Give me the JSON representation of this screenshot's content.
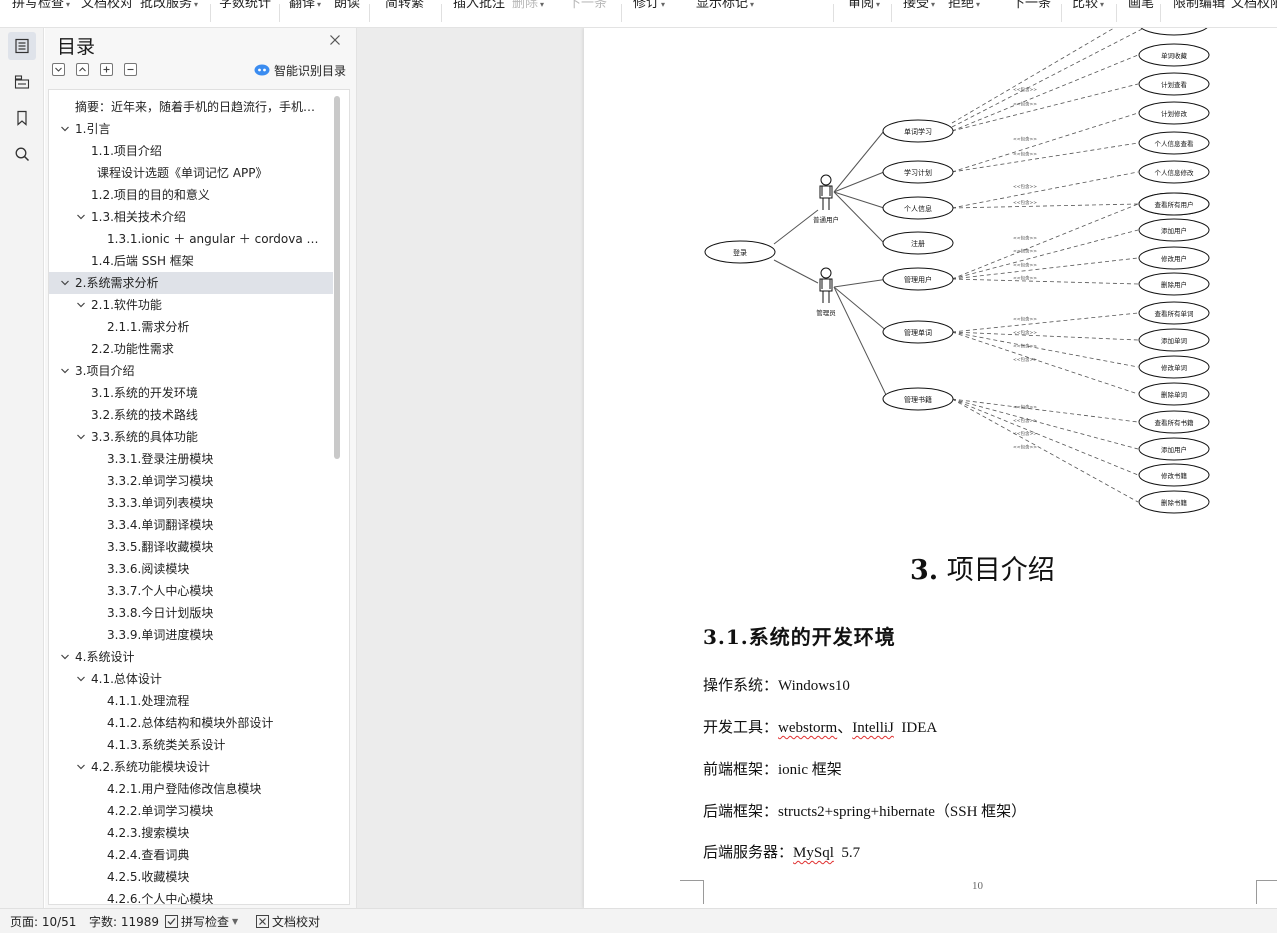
{
  "toolbar": {
    "items": [
      {
        "label": "拼写检查",
        "caret": true,
        "disabled": false
      },
      {
        "label": "文档校对",
        "caret": false,
        "disabled": false
      },
      {
        "label": "批改服务",
        "caret": true,
        "disabled": false
      },
      {
        "label": "字数统计",
        "caret": false,
        "disabled": false
      },
      {
        "label": "翻译",
        "caret": true,
        "disabled": false
      },
      {
        "label": "朗读",
        "caret": false,
        "disabled": false
      },
      {
        "label": "简转繁",
        "caret": false,
        "disabled": false
      },
      {
        "label": "插入批注",
        "caret": false,
        "disabled": false
      },
      {
        "label": "删除",
        "caret": true,
        "disabled": true
      },
      {
        "label": "下一条",
        "caret": false,
        "disabled": true
      },
      {
        "label": "修订",
        "caret": true,
        "disabled": false
      },
      {
        "label": "显示标记",
        "caret": true,
        "disabled": false
      },
      {
        "label": "审阅",
        "caret": true,
        "disabled": false
      },
      {
        "label": "接受",
        "caret": true,
        "disabled": false
      },
      {
        "label": "拒绝",
        "caret": true,
        "disabled": false
      },
      {
        "label": "下一条",
        "caret": false,
        "disabled": false
      },
      {
        "label": "比较",
        "caret": true,
        "disabled": false
      },
      {
        "label": "画笔",
        "caret": false,
        "disabled": false
      },
      {
        "label": "限制编辑",
        "caret": false,
        "disabled": false
      },
      {
        "label": "文档权限",
        "caret": false,
        "disabled": false
      }
    ]
  },
  "rail": [
    {
      "icon": "toc-icon",
      "active": true
    },
    {
      "icon": "folder-tree-icon",
      "active": false
    },
    {
      "icon": "bookmark-icon",
      "active": false
    },
    {
      "icon": "search-icon",
      "active": false
    }
  ],
  "toc": {
    "title": "目录",
    "smart_label": "智能识别目录",
    "items": [
      {
        "text": "摘要：近年来，随着手机的日趋流行，手机…",
        "level": 0,
        "toggle": "none",
        "selected": false
      },
      {
        "text": "1.引言",
        "level": 0,
        "toggle": "expanded",
        "selected": false
      },
      {
        "text": "1.1.项目介绍",
        "level": 1,
        "toggle": "none",
        "selected": false
      },
      {
        "text": "课程设计选题《单词记忆 APP》",
        "level": 1,
        "toggle": "none",
        "selected": false,
        "extra": 6
      },
      {
        "text": "1.2.项目的目的和意义",
        "level": 1,
        "toggle": "none",
        "selected": false
      },
      {
        "text": "1.3.相关技术介绍",
        "level": 1,
        "toggle": "expanded",
        "selected": false
      },
      {
        "text": "1.3.1.ionic ＋ angular ＋ cordova 混…",
        "level": 2,
        "toggle": "none",
        "selected": false
      },
      {
        "text": "1.4.后端 SSH 框架",
        "level": 1,
        "toggle": "none",
        "selected": false
      },
      {
        "text": "2.系统需求分析",
        "level": 0,
        "toggle": "expanded",
        "selected": true
      },
      {
        "text": "2.1.软件功能",
        "level": 1,
        "toggle": "expanded",
        "selected": false
      },
      {
        "text": "2.1.1.需求分析",
        "level": 2,
        "toggle": "none",
        "selected": false
      },
      {
        "text": "2.2.功能性需求",
        "level": 1,
        "toggle": "none",
        "selected": false
      },
      {
        "text": "3.项目介绍",
        "level": 0,
        "toggle": "expanded",
        "selected": false
      },
      {
        "text": "3.1.系统的开发环境",
        "level": 1,
        "toggle": "none",
        "selected": false
      },
      {
        "text": "3.2.系统的技术路线",
        "level": 1,
        "toggle": "none",
        "selected": false
      },
      {
        "text": "3.3.系统的具体功能",
        "level": 1,
        "toggle": "expanded",
        "selected": false
      },
      {
        "text": "3.3.1.登录注册模块",
        "level": 2,
        "toggle": "none",
        "selected": false
      },
      {
        "text": "3.3.2.单词学习模块",
        "level": 2,
        "toggle": "none",
        "selected": false
      },
      {
        "text": "3.3.3.单词列表模块",
        "level": 2,
        "toggle": "none",
        "selected": false
      },
      {
        "text": "3.3.4.单词翻译模块",
        "level": 2,
        "toggle": "none",
        "selected": false
      },
      {
        "text": "3.3.5.翻译收藏模块",
        "level": 2,
        "toggle": "none",
        "selected": false
      },
      {
        "text": "3.3.6.阅读模块",
        "level": 2,
        "toggle": "none",
        "selected": false
      },
      {
        "text": "3.3.7.个人中心模块",
        "level": 2,
        "toggle": "none",
        "selected": false
      },
      {
        "text": "3.3.8.今日计划版块",
        "level": 2,
        "toggle": "none",
        "selected": false
      },
      {
        "text": "3.3.9.单词进度模块",
        "level": 2,
        "toggle": "none",
        "selected": false
      },
      {
        "text": "4.系统设计",
        "level": 0,
        "toggle": "expanded",
        "selected": false
      },
      {
        "text": "4.1.总体设计",
        "level": 1,
        "toggle": "expanded",
        "selected": false
      },
      {
        "text": "4.1.1.处理流程",
        "level": 2,
        "toggle": "none",
        "selected": false
      },
      {
        "text": "4.1.2.总体结构和模块外部设计",
        "level": 2,
        "toggle": "none",
        "selected": false
      },
      {
        "text": "4.1.3.系统类关系设计",
        "level": 2,
        "toggle": "none",
        "selected": false
      },
      {
        "text": "4.2.系统功能模块设计",
        "level": 1,
        "toggle": "expanded",
        "selected": false
      },
      {
        "text": "4.2.1.用户登陆修改信息模块",
        "level": 2,
        "toggle": "none",
        "selected": false
      },
      {
        "text": "4.2.2.单词学习模块",
        "level": 2,
        "toggle": "none",
        "selected": false
      },
      {
        "text": "4.2.3.搜索模块",
        "level": 2,
        "toggle": "none",
        "selected": false
      },
      {
        "text": "4.2.4.查看词典",
        "level": 2,
        "toggle": "none",
        "selected": false
      },
      {
        "text": "4.2.5.收藏模块",
        "level": 2,
        "toggle": "none",
        "selected": false
      },
      {
        "text": "4.2.6.个人中心模块",
        "level": 2,
        "toggle": "none",
        "selected": false
      }
    ]
  },
  "diagram": {
    "login": "登录",
    "actor_user": "普通用户",
    "actor_admin": "管理员",
    "relation": "<<包含>>",
    "user_cases": [
      {
        "label": "单词学习",
        "subs": [
          "单词收藏",
          "计划查看"
        ]
      },
      {
        "label": "学习计划",
        "subs": [
          "计划修改",
          "个人信息查看"
        ]
      },
      {
        "label": "个人信息",
        "subs": [
          "个人信息修改",
          "查看所有用户"
        ]
      },
      {
        "label": "注册",
        "subs": []
      }
    ],
    "admin_cases": [
      {
        "label": "管理用户",
        "subs": [
          "查看所有用户",
          "添加用户",
          "修改用户",
          "删除用户"
        ]
      },
      {
        "label": "管理单词",
        "subs": [
          "查看所有单词",
          "添加单词",
          "修改单词",
          "删除单词"
        ]
      },
      {
        "label": "管理书籍",
        "subs": [
          "查看所有书籍",
          "添加用户",
          "修改书籍",
          "删除书籍"
        ]
      }
    ]
  },
  "document": {
    "h1_num": "3.",
    "h1_text": "项目介绍",
    "h2": "3.1.系统的开发环境",
    "os": {
      "label": "操作系统：",
      "value": "Windows10"
    },
    "tools": {
      "label": "开发工具：",
      "value1": "webstorm",
      "sep": "、",
      "value2": "IntelliJ",
      "value3": "IDEA"
    },
    "frontend": {
      "label": "前端框架：",
      "value": "ionic 框架"
    },
    "backend": {
      "label": "后端框架：",
      "value": "structs2+spring+hibernate（SSH 框架）"
    },
    "server": {
      "label": "后端服务器：",
      "value1": "MySql",
      "value2": "5.7"
    },
    "page_number": "10"
  },
  "status": {
    "page": "页面: 10/51",
    "words": "字数: 11989",
    "spell": "拼写检查",
    "proof": "文档校对"
  }
}
